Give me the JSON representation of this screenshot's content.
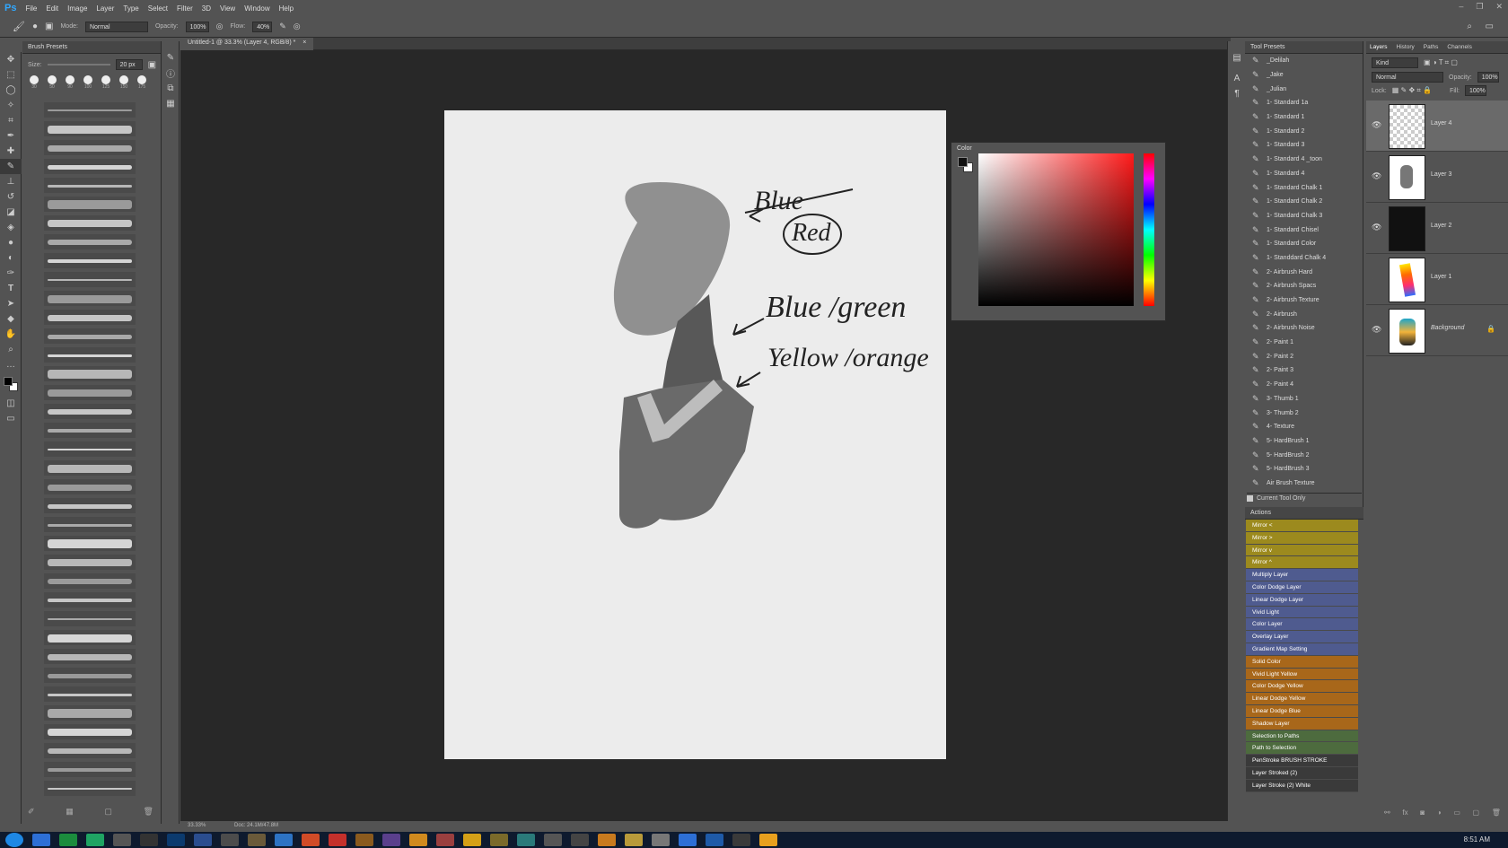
{
  "app": {
    "logo": "Ps"
  },
  "menu": [
    "File",
    "Edit",
    "Image",
    "Layer",
    "Type",
    "Select",
    "Filter",
    "3D",
    "View",
    "Window",
    "Help"
  ],
  "options": {
    "mode_label": "Mode:",
    "mode_value": "Normal",
    "opacity_label": "Opacity:",
    "opacity_value": "100%",
    "flow_label": "Flow:",
    "flow_value": "40%"
  },
  "brush_panel": {
    "title": "Brush Presets",
    "size_label": "Size:",
    "size_value": "20 px",
    "top_sizes": [
      "30",
      "50",
      "90",
      "100",
      "125",
      "150",
      "175"
    ],
    "brush_sizes": [
      "",
      "",
      "",
      "",
      "",
      "",
      "",
      "",
      "",
      "",
      "",
      "",
      "",
      "",
      "",
      "",
      "",
      "",
      "",
      "",
      "",
      "",
      "",
      "",
      "",
      "",
      "",
      "",
      "",
      "",
      "",
      "",
      "",
      "",
      "",
      "",
      ""
    ]
  },
  "document": {
    "tab_title": "Untitled-1 @ 33.3% (Layer 4, RGB/8) *",
    "close": "×"
  },
  "annotations": {
    "struck": "Blue",
    "red": "Red",
    "line2": "Blue /green",
    "line3": "Yellow /orange"
  },
  "color_panel": {
    "title": "Color"
  },
  "tool_presets": {
    "title": "Tool Presets",
    "items": [
      "_Delilah",
      "_Jake",
      "_Julian",
      "1- Standard 1a",
      "1- Standard 1",
      "1- Standard 2",
      "1- Standard 3",
      "1- Standard 4 _toon",
      "1- Standard 4",
      "1- Standard Chalk 1",
      "1- Standard Chalk 2",
      "1- Standard Chalk 3",
      "1- Standard Chisel",
      "1- Standard Color",
      "1- Standdard Chalk 4",
      "2- Airbrush Hard",
      "2- Airbrush Spacs",
      "2- Airbrush Texture",
      "2- Airbrush",
      "2- Airbrush Noise",
      "2- Paint 1",
      "2- Paint 2",
      "2- Paint 3",
      "2- Paint 4",
      "3- Thumb 1",
      "3- Thumb 2",
      "4- Texture",
      "5- HardBrush 1",
      "5- HardBrush 2",
      "5- HardBrush 3",
      "Air Brush Texture"
    ],
    "current_tool_only": "Current Tool Only"
  },
  "actions": {
    "title": "Actions",
    "items": [
      {
        "label": "Mirror <",
        "color": "#9c8a1e"
      },
      {
        "label": "Mirror >",
        "color": "#9c8a1e"
      },
      {
        "label": "Mirror v",
        "color": "#9c8a1e"
      },
      {
        "label": "Mirror ^",
        "color": "#9c8a1e"
      },
      {
        "label": "Multiply Layer",
        "color": "#4f5b8f"
      },
      {
        "label": "Color Dodge Layer",
        "color": "#4f5b8f"
      },
      {
        "label": "Linear Dodge Layer",
        "color": "#4f5b8f"
      },
      {
        "label": "Vivid Light",
        "color": "#4f5b8f"
      },
      {
        "label": "Color Layer",
        "color": "#4f5b8f"
      },
      {
        "label": "Overlay Layer",
        "color": "#4f5b8f"
      },
      {
        "label": "Gradient Map Setting",
        "color": "#4f5b8f"
      },
      {
        "label": "Solid Color",
        "color": "#a8671a"
      },
      {
        "label": "Vivid Light Yellow",
        "color": "#a8671a"
      },
      {
        "label": "Color Dodge Yellow",
        "color": "#a8671a"
      },
      {
        "label": "Linear Dodge Yellow",
        "color": "#a8671a"
      },
      {
        "label": "Linear Dodge Blue",
        "color": "#a8671a"
      },
      {
        "label": "Shadow Layer",
        "color": "#a8671a"
      },
      {
        "label": "Selection to Paths",
        "color": "#4d6b3e"
      },
      {
        "label": "Path to Selection",
        "color": "#4d6b3e"
      },
      {
        "label": "PenStroke BRUSH STROKE",
        "color": "#3a3a3a"
      },
      {
        "label": "Layer Stroked (2)",
        "color": "#3a3a3a"
      },
      {
        "label": "Layer Stroke (2) White",
        "color": "#3a3a3a"
      }
    ]
  },
  "layers_panel": {
    "tabs": [
      "Layers",
      "History",
      "Paths",
      "Channels"
    ],
    "kind": "Kind",
    "blend": "Normal",
    "opacity_label": "Opacity:",
    "opacity_value": "100%",
    "lock_label": "Lock:",
    "fill_label": "Fill:",
    "fill_value": "100%",
    "layers": [
      "Layer 4",
      "Layer 3",
      "Layer 2",
      "Layer 1",
      "Background"
    ]
  },
  "status": {
    "zoom": "33.33%",
    "doc": "Doc: 24.1M/47.8M"
  },
  "taskbar": {
    "time": "8:51 AM"
  }
}
